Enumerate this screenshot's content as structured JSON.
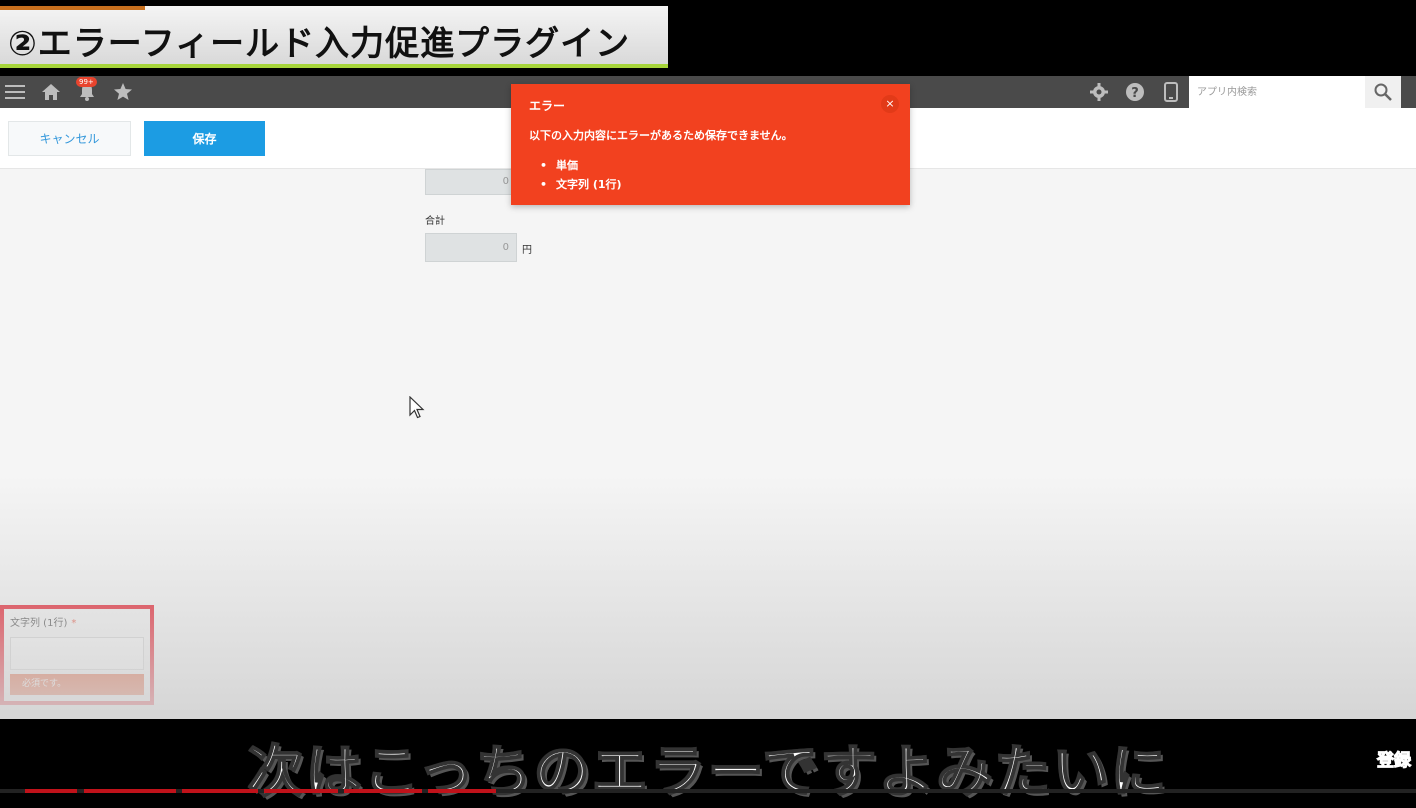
{
  "banner": {
    "title": "②エラーフィールド入力促進プラグイン"
  },
  "topbar": {
    "menu_icon": "menu-icon",
    "home_icon": "home-icon",
    "bell_icon": "bell-icon",
    "notification_badge": "99+",
    "star_icon": "star-icon",
    "gear_icon": "gear-icon",
    "help_icon": "help-icon",
    "mobile_icon": "mobile-icon",
    "search_placeholder": "アプリ内検索",
    "search_icon": "search-icon"
  },
  "actions": {
    "cancel_label": "キャンセル",
    "save_label": "保存"
  },
  "form": {
    "top_field_value": "0",
    "total_label": "合計",
    "total_value": "0",
    "total_unit": "円"
  },
  "error_popup": {
    "title": "エラー",
    "close": "×",
    "message": "以下の入力内容にエラーがあるため保存できません。",
    "items": [
      "単価",
      "文字列 (1行)"
    ]
  },
  "required_field": {
    "label": "文字列 (1行)",
    "required_mark": "*",
    "value": "",
    "error_text": "必須です。"
  },
  "caption": {
    "text": "次はこっちのエラーですよみたいに",
    "subscribe": "登録"
  },
  "colors": {
    "error_red": "#f2411f",
    "save_blue": "#1c9ce3",
    "highlight_red": "#e60012",
    "topbar_gray": "#4a4a4a"
  }
}
